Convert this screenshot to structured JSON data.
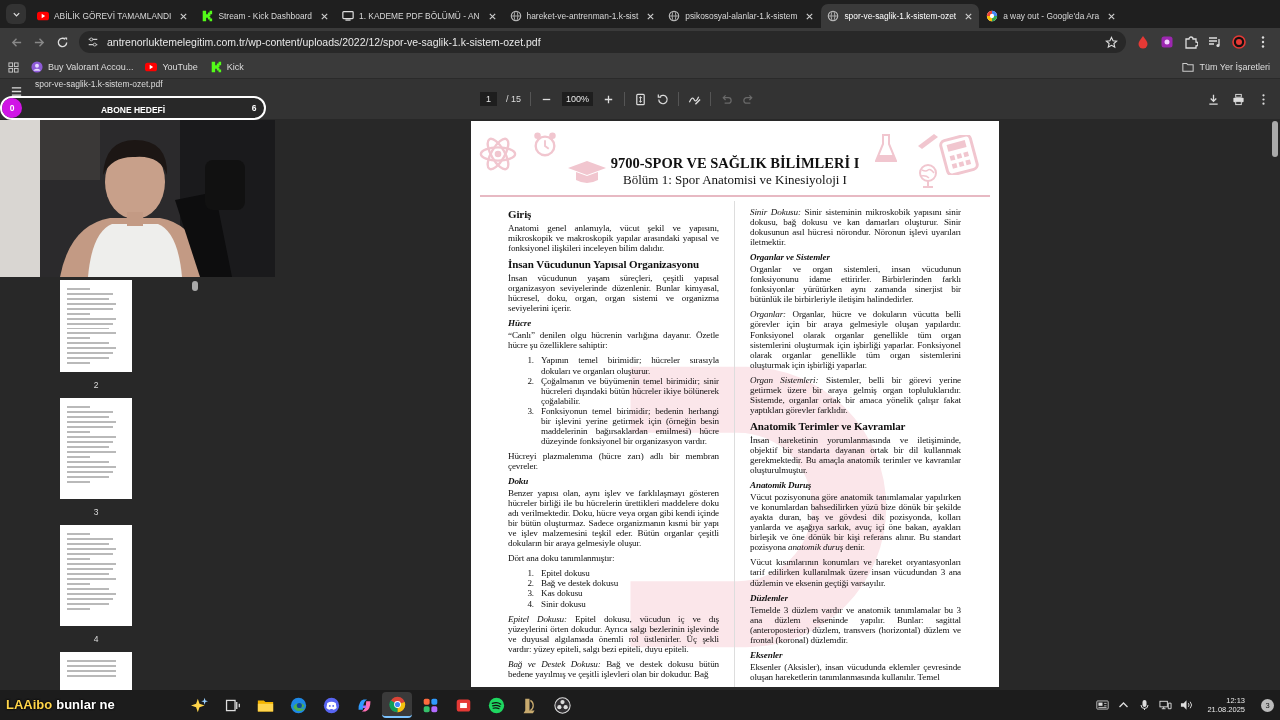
{
  "browser": {
    "tabs": [
      {
        "title": "ABİLİK GÖREVİ TAMAMLANDI",
        "selected": false
      },
      {
        "title": "Stream - Kick Dashboard",
        "selected": false
      },
      {
        "title": "1. KADEME PDF BÖLÜMÜ - AN",
        "selected": false
      },
      {
        "title": "hareket-ve-antrenman-1.k-sist",
        "selected": false
      },
      {
        "title": "psikososyal-alanlar-1.k-sistem",
        "selected": false
      },
      {
        "title": "spor-ve-saglik-1.k-sistem-ozet",
        "selected": true
      },
      {
        "title": "a way out - Google'da Ara",
        "selected": false
      }
    ],
    "url": "antrenorluktemelegitim.com.tr/wp-content/uploads/2022/12/spor-ve-saglik-1.k-sistem-ozet.pdf",
    "bookmarks": [
      {
        "label": "Buy Valorant Accou..."
      },
      {
        "label": "YouTube"
      },
      {
        "label": "Kick"
      }
    ],
    "all_bookmarks": "Tüm Yer İşaretleri"
  },
  "viewer": {
    "file_title": "spor-ve-saglik-1.k-sistem-ozet.pdf",
    "page": "1",
    "page_count": "/ 15",
    "zoom": "100%",
    "undo_disabled": true,
    "redo_disabled": true
  },
  "thumbnails": [
    {
      "label": "2"
    },
    {
      "label": "3"
    },
    {
      "label": "4"
    }
  ],
  "stream_overlay": {
    "goal_current": "0",
    "goal_label": "ABONE HEDEFİ",
    "goal_target": "6",
    "chat_user": "LAAibo",
    "chat_message": "bunlar ne"
  },
  "document": {
    "title": "9700-SPOR VE SAĞLIK BİLİMLERİ I",
    "subtitle": "Bölüm 1: Spor Anatomisi ve Kinesiyoloji I",
    "columns": [
      [
        {
          "kind": "heading",
          "text": "Giriş"
        },
        {
          "kind": "paragraph",
          "text": "Anatomi genel anlamıyla, vücut şekil ve yapısını, mikroskopik ve makroskopik yapılar arasındaki yapısal ve fonksiyonel ilişkileri inceleyen bilim dalıdır."
        },
        {
          "kind": "heading",
          "text": "İnsan Vücudunun Yapısal Organizasyonu"
        },
        {
          "kind": "paragraph",
          "text": "İnsan vücudunun yaşam süreçleri, çeşitli yapısal organizasyon seviyelerinde düzenlenir. Bunlar kimyasal, hücresel, doku, organ, organ sistemi ve organizma seviyelerini içerir."
        },
        {
          "kind": "subheading",
          "text": "Hücre"
        },
        {
          "kind": "paragraph",
          "text": "“Canlı” denilen olgu hücrenin varlığına dayanır. Özetle hücre şu özelliklere sahiptir:"
        },
        {
          "kind": "list",
          "items": [
            {
              "num": "1.",
              "text": "Yapının temel birimidir; hücreler sırasıyla dokuları ve organları oluşturur."
            },
            {
              "num": "2.",
              "text": "Çoğalmanın ve büyümenin temel birimidir; sinir hücreleri dışındaki bütün hücreler ikiye bölünerek çoğalabilir."
            },
            {
              "num": "3.",
              "text": "Fonksiyonun temel birimidir; bedenin herhangi bir işlevini yerine getirmek için (örneğin besin maddelerinin bağırsaklardan emilmesi) hücre düzeyinde fonksiyonel bir organizasyon vardır."
            }
          ]
        },
        {
          "kind": "paragraph",
          "text": "Hücreyi plazmalemma (hücre zarı) adlı bir membran çevreler."
        },
        {
          "kind": "subheading",
          "text": "Doku"
        },
        {
          "kind": "paragraph",
          "text": "Benzer yapısı olan, aynı işlev ve farklılaşmayı gösteren hücreler birliği ile bu hücrelerin ürettikleri maddelere doku adı verilmektedir. Doku, hücre veya organ gibi kendi içinde bir bütün oluşturmaz. Sadece organizmanın kısmi bir yapı ve işlev malzemesini teşkil eder. Bütün organlar çeşitli dokuların bir araya gelmesiyle oluşur."
        },
        {
          "kind": "paragraph",
          "text": "Dört ana doku tanımlanmıştır:"
        },
        {
          "kind": "list",
          "items": [
            {
              "num": "1.",
              "text": "Epitel dokusu"
            },
            {
              "num": "2.",
              "text": "Bağ ve destek dokusu"
            },
            {
              "num": "3.",
              "text": "Kas dokusu"
            },
            {
              "num": "4.",
              "text": "Sinir dokusu"
            }
          ]
        },
        {
          "kind": "paragraph",
          "text": "*Epitel Dokusu:* Epitel dokusu, vücudun iç ve dış yüzeylerini örten dokudur. Ayrıca salgı bezlerinin işlevinde ve duyusal algılamada önemli rol üstlenirler. Üç şekli vardır: yüzey epiteli, salgı bezi epiteli, duyu epiteli."
        },
        {
          "kind": "paragraph",
          "text": "*Bağ ve Destek Dokusu:* Bağ ve destek dokusu bütün bedene yayılmış ve çeşitli işlevleri olan bir dokudur. Bağ"
        }
      ],
      [
        {
          "kind": "paragraph",
          "text": "*Sinir Dokusu:* Sinir sisteminin mikroskobik yapısını sinir dokusu, bağ dokusu ve kan damarları oluşturur. Sinir dokusunun asıl hücresi nörondur. Nöronun işlevi uyarıları iletmektir."
        },
        {
          "kind": "subheading",
          "text": "Organlar ve Sistemler"
        },
        {
          "kind": "paragraph",
          "text": "Organlar ve organ sistemleri, insan vücudunun fonksiyonunu idame ettirirler. Birbirlerinden farklı fonksiyonlar yürütürken aynı zamanda sinerjist bir bütünlük ile birbirleriyle iletişim halindedirler."
        },
        {
          "kind": "paragraph",
          "text": "*Organlar:* Organlar, hücre ve dokuların vücutta belli görevler için bir araya gelmesiyle oluşan yapılardır. Fonksiyonel olarak organlar genellikle tüm organ sistemlerini oluşturmak için işbirliği yaparlar. Fonksiyonel olarak organlar genellikle tüm organ sistemlerini oluşturmak için işbirliği yaparlar."
        },
        {
          "kind": "paragraph",
          "text": "*Organ Sistemleri:* Sistemler, belli bir görevi yerine getirmek üzere bir araya gelmiş organ topluluklarıdır. Sistemde, organlar ortak bir amaca yönelik çalışır fakat yaptıkları görevler farklıdır."
        },
        {
          "kind": "heading",
          "text": "Anatomik Terimler ve Kavramlar"
        },
        {
          "kind": "paragraph",
          "text": "İnsan hareketinin yorumlanmasında ve iletişiminde, objektif bir standarta dayanan ortak bir dil kullanmak gerekmektedir. Bu amaçla anatomik terimler ve kavramlar oluşturulmuştur."
        },
        {
          "kind": "subheading",
          "text": "Anatomik Duruş"
        },
        {
          "kind": "paragraph",
          "text": "Vücut pozisyonuna göre anatomik tanımlamalar yapılırken ve konumlardan bahsedilirken yüzü bize dönük bir şekilde ayakta duran, baş ve gövdesi dik pozisyonda, kolları yanlarda ve aşağıya sarkık, avuç içi öne bakan, ayakları birleşik ve öne dönük bir kişi referans alınır. Bu standart pozisyona *anatomik duruş* denir."
        },
        {
          "kind": "paragraph",
          "text": "Vücut kısımlarının konumları ve hareket oryantasyonları tarif edilirken kullanılmak üzere insan vücudundan 3 ana düzlemin ve eksenin geçtiği varsayılır."
        },
        {
          "kind": "subheading",
          "text": "Düzlemler"
        },
        {
          "kind": "paragraph",
          "text": "Temelde 3 düzlem vardır ve anatomik tanımlamalar bu 3 ana düzlem ekseninde yapılır. Bunlar: sagittal (anteroposterior) düzlem, transvers (horizontal) düzlem ve frontal (koronal) düzlemdir."
        },
        {
          "kind": "subheading",
          "text": "Eksenler"
        },
        {
          "kind": "paragraph",
          "text": "Eksenler (Aksisler), insan vücudunda eklemler çevresinde oluşan hareketlerin tanımlanmasında kullanılır. Temel"
        }
      ]
    ]
  },
  "taskbar": {
    "apps": [
      {
        "kind": "sparkles",
        "active": false
      },
      {
        "kind": "taskview",
        "active": false
      },
      {
        "kind": "folder",
        "active": false
      },
      {
        "kind": "edge",
        "active": false
      },
      {
        "kind": "discord",
        "active": false
      },
      {
        "kind": "copilot",
        "active": false
      },
      {
        "kind": "chrome",
        "active": true
      },
      {
        "kind": "office",
        "active": false
      },
      {
        "kind": "red",
        "active": false
      },
      {
        "kind": "spotify",
        "active": false
      },
      {
        "kind": "league",
        "active": false
      },
      {
        "kind": "obs",
        "active": false
      }
    ],
    "time": "12:13",
    "date": "21.08.2025",
    "notifications": "3"
  }
}
